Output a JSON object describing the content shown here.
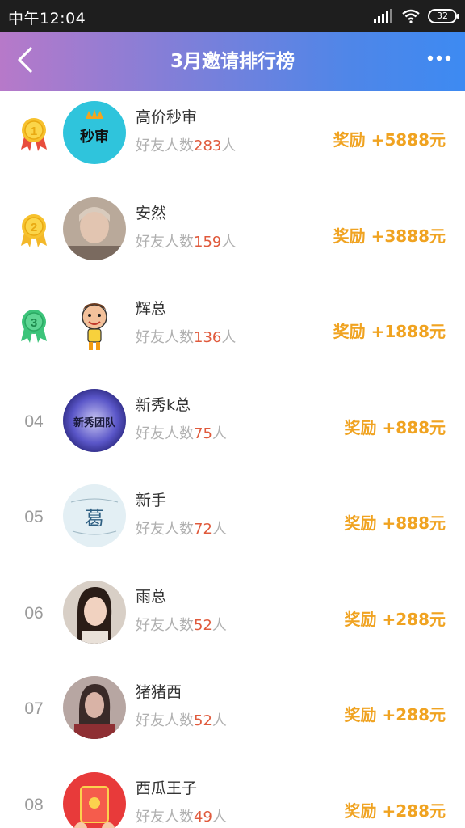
{
  "status_bar": {
    "time": "中午12:04",
    "battery": "32"
  },
  "header": {
    "title": "3月邀请排行榜"
  },
  "list": {
    "friends_prefix": "好友人数",
    "friends_suffix": "人",
    "items": [
      {
        "rank": "1",
        "name": "高价秒审",
        "friends": "283",
        "reward": "奖励 +5888元",
        "avatar_text": "秒审",
        "medal": "gold"
      },
      {
        "rank": "2",
        "name": "安然",
        "friends": "159",
        "reward": "奖励 +3888元",
        "medal": "gold"
      },
      {
        "rank": "3",
        "name": "辉总",
        "friends": "136",
        "reward": "奖励 +1888元",
        "medal": "green"
      },
      {
        "rank": "04",
        "name": "新秀k总",
        "friends": "75",
        "reward": "奖励 +888元",
        "avatar_text": "新秀团队"
      },
      {
        "rank": "05",
        "name": "新手",
        "friends": "72",
        "reward": "奖励 +888元",
        "avatar_text": "葛"
      },
      {
        "rank": "06",
        "name": "雨总",
        "friends": "52",
        "reward": "奖励 +288元"
      },
      {
        "rank": "07",
        "name": "猪猪西",
        "friends": "52",
        "reward": "奖励 +288元"
      },
      {
        "rank": "08",
        "name": "西瓜王子",
        "friends": "49",
        "reward": "奖励 +288元"
      }
    ]
  },
  "colors": {
    "reward": "#f0a321",
    "count": "#e05a3c",
    "header_start": "#b779c9",
    "header_end": "#3d8af2"
  }
}
